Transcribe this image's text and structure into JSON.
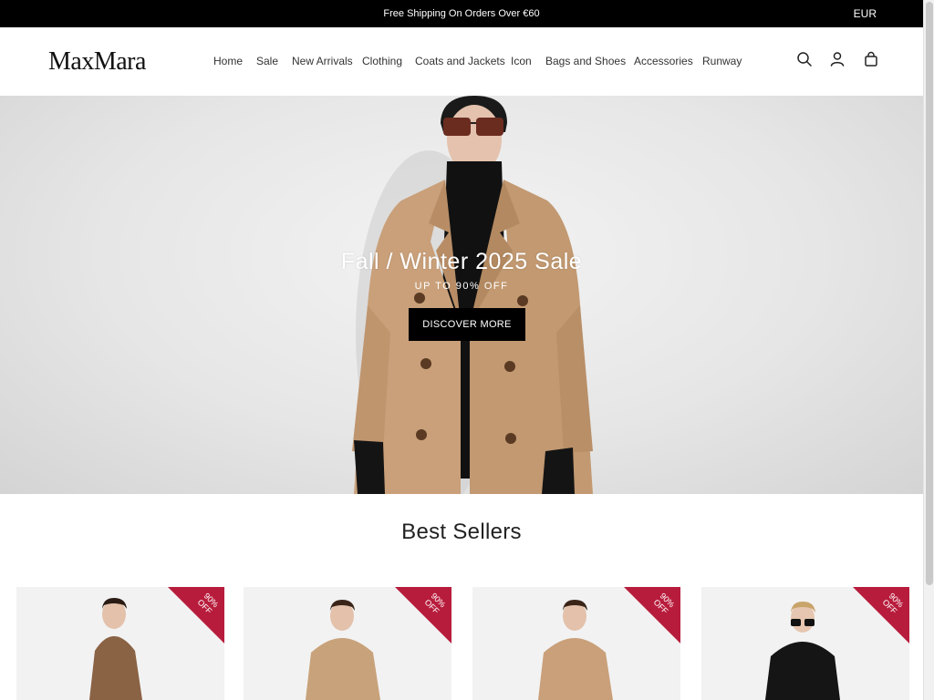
{
  "announcement": {
    "text": "Free Shipping On Orders Over €60",
    "currency": "EUR"
  },
  "header": {
    "logo": "MaxMara",
    "nav": [
      "Home",
      "Sale",
      "New Arrivals",
      "Clothing",
      "Coats and Jackets",
      "Icon",
      "Bags and Shoes",
      "Accessories",
      "Runway"
    ],
    "icons": [
      "search-icon",
      "account-icon",
      "bag-icon"
    ]
  },
  "hero": {
    "title": "Fall / Winter 2025 Sale",
    "subtitle": "UP TO 90% OFF",
    "button": "DISCOVER MORE"
  },
  "best_sellers": {
    "title": "Best Sellers",
    "products": [
      {
        "badge_line1": "90%",
        "badge_line2": "OFF",
        "coat_color": "#8a6244"
      },
      {
        "badge_line1": "90%",
        "badge_line2": "OFF",
        "coat_color": "#c8a27a"
      },
      {
        "badge_line1": "90%",
        "badge_line2": "OFF",
        "coat_color": "#c9a07a"
      },
      {
        "badge_line1": "90%",
        "badge_line2": "OFF",
        "coat_color": "#151515"
      }
    ]
  },
  "colors": {
    "ribbon": "#b81c3c",
    "hero_coat": "#c9a07a",
    "black": "#000000"
  }
}
